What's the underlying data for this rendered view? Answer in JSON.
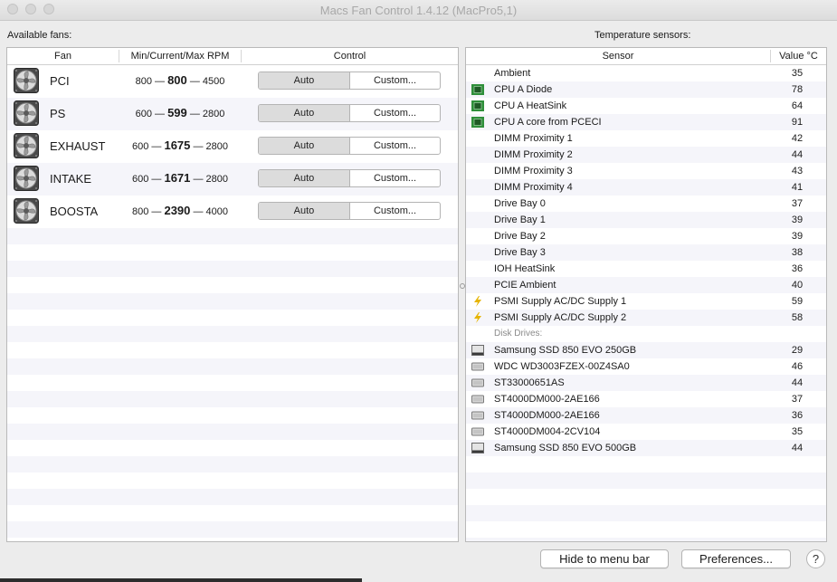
{
  "window": {
    "title": "Macs Fan Control 1.4.12 (MacPro5,1)"
  },
  "fans_panel": {
    "label": "Available fans:",
    "columns": {
      "fan": "Fan",
      "rpm": "Min/Current/Max RPM",
      "control": "Control"
    },
    "fans": [
      {
        "name": "PCI",
        "min": "800",
        "current": "800",
        "max": "4500",
        "auto_label": "Auto",
        "custom_label": "Custom..."
      },
      {
        "name": "PS",
        "min": "600",
        "current": "599",
        "max": "2800",
        "auto_label": "Auto",
        "custom_label": "Custom..."
      },
      {
        "name": "EXHAUST",
        "min": "600",
        "current": "1675",
        "max": "2800",
        "auto_label": "Auto",
        "custom_label": "Custom..."
      },
      {
        "name": "INTAKE",
        "min": "600",
        "current": "1671",
        "max": "2800",
        "auto_label": "Auto",
        "custom_label": "Custom..."
      },
      {
        "name": "BOOSTA",
        "min": "800",
        "current": "2390",
        "max": "4000",
        "auto_label": "Auto",
        "custom_label": "Custom..."
      }
    ],
    "separator": "—"
  },
  "sensors_panel": {
    "label": "Temperature sensors:",
    "columns": {
      "sensor": "Sensor",
      "value": "Value °C"
    },
    "group_label": "Disk Drives:",
    "sensors": [
      {
        "name": "Ambient",
        "value": "35",
        "icon": "none"
      },
      {
        "name": "CPU A Diode",
        "value": "78",
        "icon": "chip-icon"
      },
      {
        "name": "CPU A HeatSink",
        "value": "64",
        "icon": "chip-icon"
      },
      {
        "name": "CPU A core from PCECI",
        "value": "91",
        "icon": "chip-icon"
      },
      {
        "name": "DIMM Proximity 1",
        "value": "42",
        "icon": "none"
      },
      {
        "name": "DIMM Proximity 2",
        "value": "44",
        "icon": "none"
      },
      {
        "name": "DIMM Proximity 3",
        "value": "43",
        "icon": "none"
      },
      {
        "name": "DIMM Proximity 4",
        "value": "41",
        "icon": "none"
      },
      {
        "name": "Drive Bay 0",
        "value": "37",
        "icon": "none"
      },
      {
        "name": "Drive Bay 1",
        "value": "39",
        "icon": "none"
      },
      {
        "name": "Drive Bay 2",
        "value": "39",
        "icon": "none"
      },
      {
        "name": "Drive Bay 3",
        "value": "38",
        "icon": "none"
      },
      {
        "name": "IOH HeatSink",
        "value": "36",
        "icon": "none"
      },
      {
        "name": "PCIE Ambient",
        "value": "40",
        "icon": "none"
      },
      {
        "name": "PSMI Supply AC/DC Supply 1",
        "value": "59",
        "icon": "lightning-icon"
      },
      {
        "name": "PSMI Supply AC/DC Supply 2",
        "value": "58",
        "icon": "lightning-icon"
      }
    ],
    "drives": [
      {
        "name": "Samsung SSD 850 EVO 250GB",
        "value": "29",
        "icon": "ssd-icon"
      },
      {
        "name": "WDC WD3003FZEX-00Z4SA0",
        "value": "46",
        "icon": "hdd-icon"
      },
      {
        "name": "ST33000651AS",
        "value": "44",
        "icon": "hdd-icon"
      },
      {
        "name": "ST4000DM000-2AE166",
        "value": "37",
        "icon": "hdd-icon"
      },
      {
        "name": "ST4000DM000-2AE166",
        "value": "36",
        "icon": "hdd-icon"
      },
      {
        "name": "ST4000DM004-2CV104",
        "value": "35",
        "icon": "hdd-icon"
      },
      {
        "name": "Samsung SSD 850 EVO 500GB",
        "value": "44",
        "icon": "ssd-icon"
      }
    ]
  },
  "footer": {
    "hide_label": "Hide to menu bar",
    "preferences_label": "Preferences...",
    "help_label": "?"
  },
  "colors": {
    "chip": "#2f8f3a",
    "lightning": "#e6b400",
    "row_alt": "#f5f5fa",
    "auto_selected": "#dcdcdc"
  }
}
